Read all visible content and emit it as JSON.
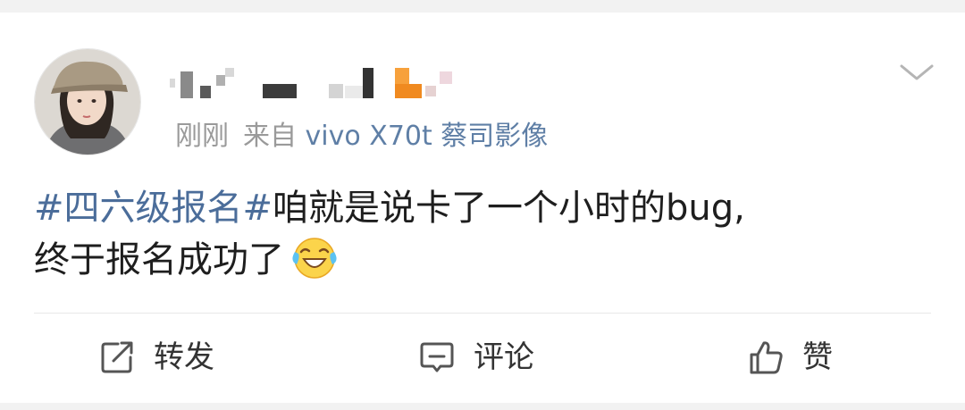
{
  "post": {
    "time": "刚刚",
    "source_prefix": "来自",
    "source_device": "vivo X70t 蔡司影像",
    "hashtag": "#四六级报名#",
    "text_line1": "咱就是说卡了一个小时的bug,",
    "text_line2": "终于报名成功了",
    "emoji": "laughing-crying-emoji"
  },
  "actions": {
    "repost_label": "转发",
    "comment_label": "评论",
    "like_label": "赞"
  },
  "colors": {
    "background": "#f2f2f2",
    "card": "#ffffff",
    "link": "#4b6d9a",
    "meta_text": "#9a9a9a",
    "body_text": "#1e1e1e"
  },
  "icons": {
    "repost": "repost-icon",
    "comment": "comment-icon",
    "like": "thumbs-up-icon",
    "menu": "chevron-down-icon"
  }
}
